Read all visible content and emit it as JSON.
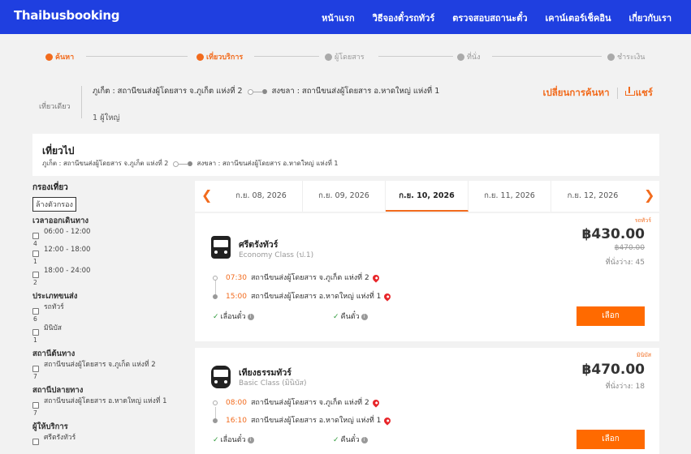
{
  "header": {
    "brand": "Thaibusbooking",
    "nav": [
      "หน้าแรก",
      "วิธีจองตั๋วรถทัวร์",
      "ตรวจสอบสถานะตั๋ว",
      "เคาน์เตอร์เช็คอิน",
      "เกี่ยวกับเรา"
    ]
  },
  "steps": [
    {
      "label": "ค้นหา",
      "active": true
    },
    {
      "label": "เที่ยวบริการ",
      "active": true
    },
    {
      "label": "ผู้โดยสาร",
      "active": false
    },
    {
      "label": "ที่นั่ง",
      "active": false
    },
    {
      "label": "ชำระเงิน",
      "active": false
    }
  ],
  "summary": {
    "trip_type": "เที่ยวเดียว",
    "from": "ภูเก็ต : สถานีขนส่งผู้โดยสาร จ.ภูเก็ต แห่งที่ 2",
    "to": "สงขลา : สถานีขนส่งผู้โดยสาร อ.หาดใหญ่ แห่งที่ 1",
    "passengers": "1 ผู้ใหญ่",
    "change_search": "เปลี่ยนการค้นหา",
    "share": "แชร์"
  },
  "outbound": {
    "title": "เที่ยวไป",
    "from": "ภูเก็ต : สถานีขนส่งผู้โดยสาร จ.ภูเก็ต แห่งที่ 2",
    "to": "สงขลา : สถานีขนส่งผู้โดยสาร อ.หาดใหญ่ แห่งที่ 1"
  },
  "filters": {
    "title": "กรองเที่ยว",
    "clear": "ล้างตัวกรอง",
    "departure_title": "เวลาออกเดินทาง",
    "departure": [
      {
        "label": "06:00 - 12:00",
        "count": "4"
      },
      {
        "label": "12:00 - 18:00",
        "count": "1"
      },
      {
        "label": "18:00 - 24:00",
        "count": "2"
      }
    ],
    "vehicle_title": "ประเภทขนส่ง",
    "vehicle": [
      {
        "label": "รถทัวร์",
        "count": "6"
      },
      {
        "label": "มินิบัส",
        "count": "1"
      }
    ],
    "origin_title": "สถานีต้นทาง",
    "origin": [
      {
        "label": "สถานีขนส่งผู้โดยสาร จ.ภูเก็ต แห่งที่ 2",
        "count": "7"
      }
    ],
    "dest_title": "สถานีปลายทาง",
    "dest": [
      {
        "label": "สถานีขนส่งผู้โดยสาร อ.หาดใหญ่ แห่งที่ 1",
        "count": "7"
      }
    ],
    "provider_title": "ผู้ให้บริการ",
    "provider_first": "ศรีตรังทัวร์"
  },
  "dates": [
    "ก.ย. 08, 2026",
    "ก.ย. 09, 2026",
    "ก.ย. 10, 2026",
    "ก.ย. 11, 2026",
    "ก.ย. 12, 2026"
  ],
  "active_date_index": 2,
  "trips": [
    {
      "badge": "รถทัวร์",
      "operator": "ศรีตรังทัวร์",
      "class": "Economy Class (ป.1)",
      "price": "฿430.00",
      "old_price": "฿470.00",
      "seats": "ที่นั่งว่าง: 45",
      "depart_time": "07:30",
      "depart_station": "สถานีขนส่งผู้โดยสาร จ.ภูเก็ต แห่งที่ 2",
      "arrive_time": "15:00",
      "arrive_station": "สถานีขนส่งผู้โดยสาร อ.หาดใหญ่ แห่งที่ 1",
      "policy1": "เลื่อนตั๋ว",
      "policy2": "คืนตั๋ว",
      "select": "เลือก"
    },
    {
      "badge": "มินิบัส",
      "operator": "เทียงธรรมทัวร์",
      "class": "Basic Class (มินิบัส)",
      "price": "฿470.00",
      "seats": "ที่นั่งว่าง: 18",
      "depart_time": "08:00",
      "depart_station": "สถานีขนส่งผู้โดยสาร จ.ภูเก็ต แห่งที่ 2",
      "arrive_time": "16:10",
      "arrive_station": "สถานีขนส่งผู้โดยสาร อ.หาดใหญ่ แห่งที่ 1",
      "policy1": "เลื่อนตั๋ว",
      "policy2": "คืนตั๋ว",
      "select": "เลือก"
    }
  ]
}
